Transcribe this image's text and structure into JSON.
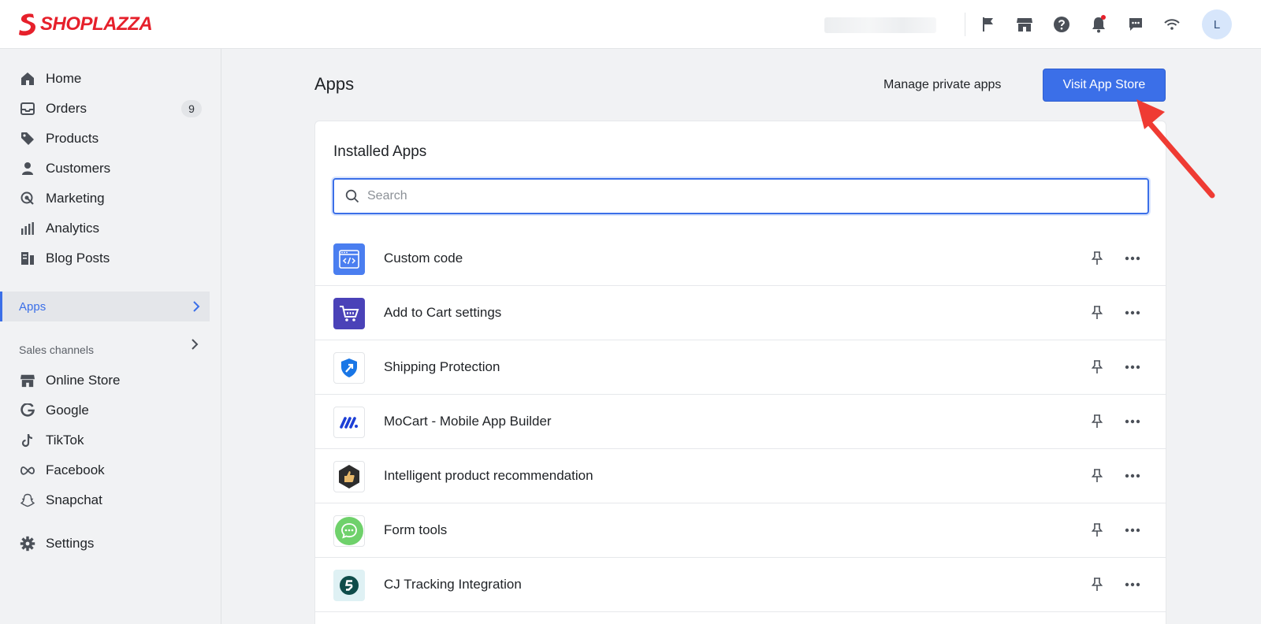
{
  "brand": {
    "name": "SHOPLAZZA",
    "color": "#e6202b"
  },
  "topbar": {
    "icons": [
      "flag-icon",
      "store-icon",
      "help-icon",
      "bell-icon",
      "chat-icon",
      "wifi-icon"
    ],
    "avatar_initial": "L"
  },
  "sidebar": {
    "items": [
      {
        "label": "Home",
        "icon": "home-icon"
      },
      {
        "label": "Orders",
        "icon": "inbox-icon",
        "badge": "9"
      },
      {
        "label": "Products",
        "icon": "tag-icon"
      },
      {
        "label": "Customers",
        "icon": "person-icon"
      },
      {
        "label": "Marketing",
        "icon": "target-icon"
      },
      {
        "label": "Analytics",
        "icon": "bar-chart-icon"
      },
      {
        "label": "Blog Posts",
        "icon": "blog-icon"
      }
    ],
    "active": {
      "label": "Apps"
    },
    "section_label": "Sales channels",
    "channels": [
      {
        "label": "Online Store",
        "icon": "store-icon"
      },
      {
        "label": "Google",
        "icon": "google-icon"
      },
      {
        "label": "TikTok",
        "icon": "tiktok-icon"
      },
      {
        "label": "Facebook",
        "icon": "meta-icon"
      },
      {
        "label": "Snapchat",
        "icon": "snapchat-icon"
      }
    ],
    "settings": {
      "label": "Settings",
      "icon": "gear-icon"
    }
  },
  "main": {
    "title": "Apps",
    "manage_link": "Manage private apps",
    "visit_button": "Visit App Store",
    "accent": "#3b6fe8",
    "card": {
      "title": "Installed Apps",
      "search_placeholder": "Search",
      "apps": [
        {
          "name": "Custom code",
          "icon": "code-window-icon"
        },
        {
          "name": "Add to Cart settings",
          "icon": "cart-icon"
        },
        {
          "name": "Shipping Protection",
          "icon": "shield-icon"
        },
        {
          "name": "MoCart - Mobile App Builder",
          "icon": "mocart-logo-icon"
        },
        {
          "name": "Intelligent product recommendation",
          "icon": "thumbs-up-hexagon-icon"
        },
        {
          "name": "Form tools",
          "icon": "chat-bubble-icon"
        },
        {
          "name": "CJ Tracking Integration",
          "icon": "cj-logo-icon"
        }
      ]
    }
  },
  "annotation": {
    "arrow_color": "#ef3b33"
  }
}
